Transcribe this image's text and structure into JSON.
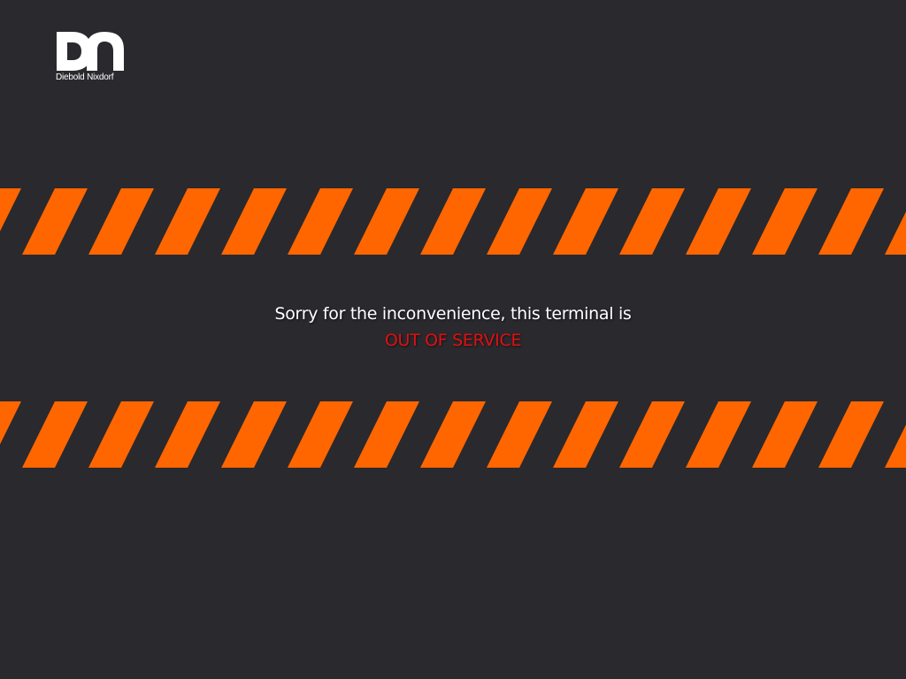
{
  "brand": {
    "logo_mark": "DN",
    "name": "Diebold Nixdorf",
    "logo_color": "#ffffff"
  },
  "message": {
    "line1": "Sorry for the inconvenience, this terminal is",
    "status": "OUT OF SERVICE",
    "text_color": "#ffffff",
    "status_color": "#e01010"
  },
  "theme": {
    "background": "#2a292e",
    "stripe_color": "#ff6600"
  }
}
